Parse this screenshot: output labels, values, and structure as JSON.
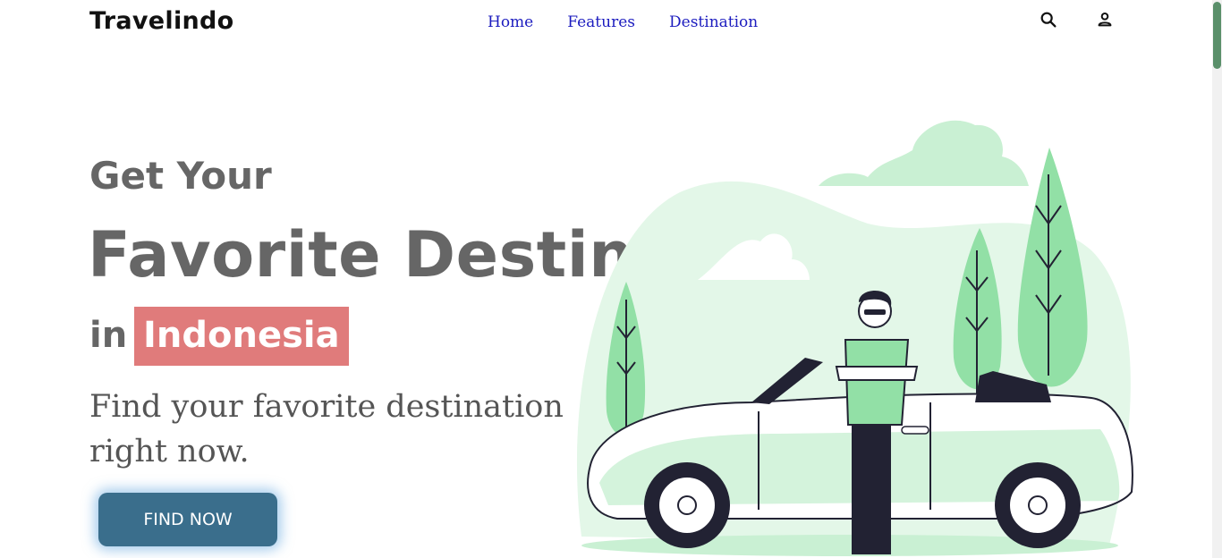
{
  "brand": {
    "name": "Travelindo"
  },
  "nav": {
    "items": [
      {
        "label": "Home"
      },
      {
        "label": "Features"
      },
      {
        "label": "Destination"
      }
    ],
    "icons": [
      "search-icon",
      "user-icon"
    ]
  },
  "hero": {
    "line1": "Get Your",
    "line2": "Favorite Destination",
    "line3_prefix": "in",
    "highlight": "Indonesia",
    "subtitle": "Find your favorite destination right now.",
    "cta_label": "FIND NOW"
  },
  "colors": {
    "accent_link": "#1c1cbf",
    "highlight_bg": "#e07b7b",
    "button_bg": "#3a6e8c",
    "illustration_green": "#92e0a6"
  }
}
